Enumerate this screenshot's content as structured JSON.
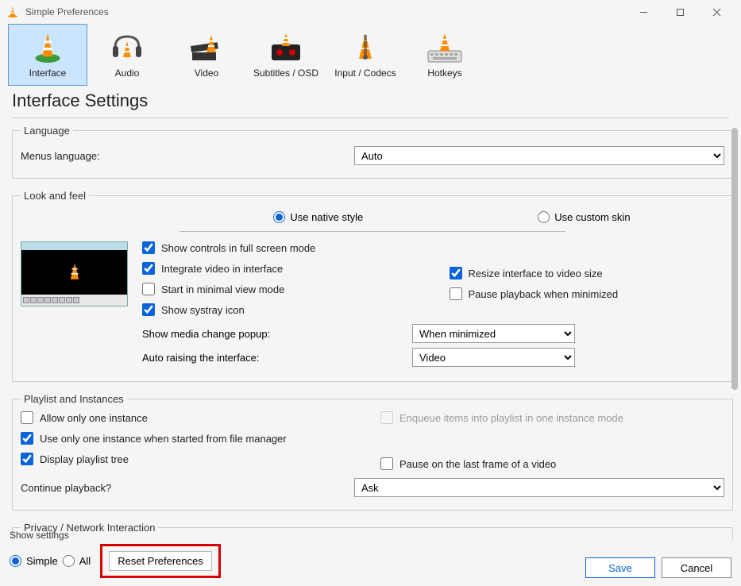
{
  "titlebar": {
    "title": "Simple Preferences"
  },
  "tabs": {
    "interface": "Interface",
    "audio": "Audio",
    "video": "Video",
    "subtitles": "Subtitles / OSD",
    "input": "Input / Codecs",
    "hotkeys": "Hotkeys"
  },
  "heading": "Interface Settings",
  "language": {
    "legend": "Language",
    "menus_label": "Menus language:",
    "menus_value": "Auto"
  },
  "look": {
    "legend": "Look and feel",
    "native": "Use native style",
    "custom": "Use custom skin",
    "show_controls": "Show controls in full screen mode",
    "integrate": "Integrate video in interface",
    "start_minimal": "Start in minimal view mode",
    "systray": "Show systray icon",
    "resize": "Resize interface to video size",
    "pause_min": "Pause playback when minimized",
    "media_popup_label": "Show media change popup:",
    "media_popup_value": "When minimized",
    "auto_raise_label": "Auto raising the interface:",
    "auto_raise_value": "Video"
  },
  "playlist": {
    "legend": "Playlist and Instances",
    "allow_one": "Allow only one instance",
    "use_one_fm": "Use only one instance when started from file manager",
    "display_tree": "Display playlist tree",
    "enqueue": "Enqueue items into playlist in one instance mode",
    "pause_last": "Pause on the last frame of a video",
    "continue_label": "Continue playback?",
    "continue_value": "Ask"
  },
  "privacy": {
    "legend": "Privacy / Network Interaction"
  },
  "footer": {
    "show_settings": "Show settings",
    "simple": "Simple",
    "all": "All",
    "reset": "Reset Preferences",
    "save": "Save",
    "cancel": "Cancel"
  }
}
